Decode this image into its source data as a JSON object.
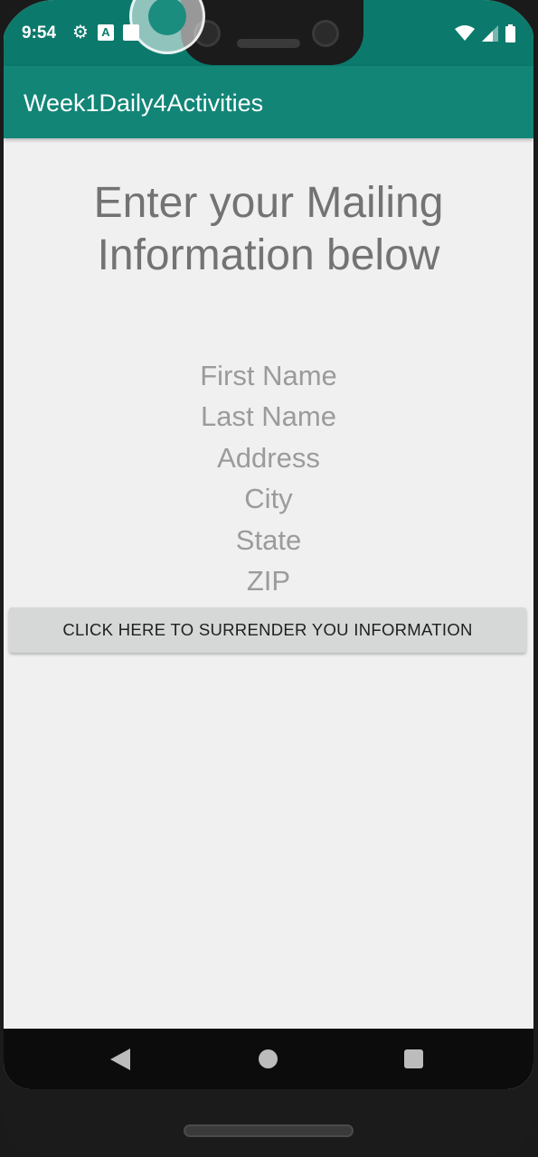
{
  "status_bar": {
    "time": "9:54",
    "icons_left": [
      "gear-icon",
      "a-notification-icon",
      "sim-icon"
    ],
    "icons_right": [
      "wifi-icon",
      "signal-icon",
      "battery-icon"
    ],
    "color": "#0b7a6c"
  },
  "app_bar": {
    "title": "Week1Daily4Activities",
    "color": "#128577"
  },
  "main": {
    "heading_line1": "Enter your Mailing",
    "heading_line2": "Information below",
    "fields": [
      {
        "placeholder": "First Name"
      },
      {
        "placeholder": "Last Name"
      },
      {
        "placeholder": "Address"
      },
      {
        "placeholder": "City"
      },
      {
        "placeholder": "State"
      },
      {
        "placeholder": "ZIP"
      }
    ],
    "submit_label": "CLICK HERE TO SURRENDER YOU INFORMATION"
  },
  "nav_bar": {
    "buttons": [
      "back-icon",
      "home-icon",
      "recents-icon"
    ]
  }
}
